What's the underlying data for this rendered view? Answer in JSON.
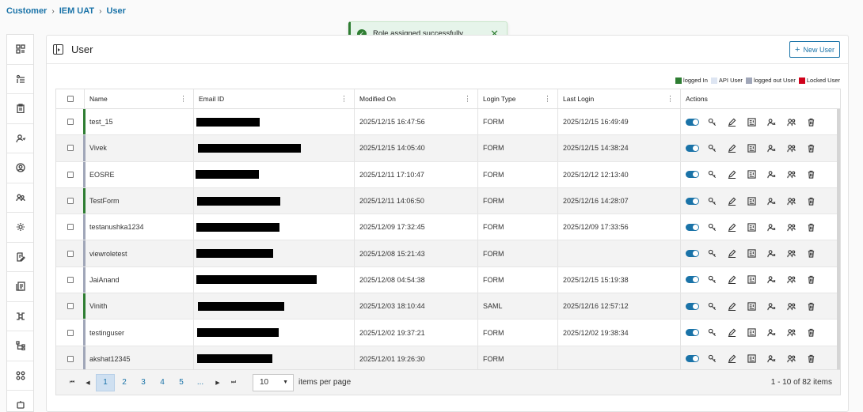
{
  "breadcrumb": [
    "Customer",
    "IEM UAT",
    "User"
  ],
  "sidebar": [
    "dashboard-icon",
    "tasks-icon",
    "clipboard-icon",
    "user-check-icon",
    "account-circle-icon",
    "group-icon",
    "settings-icon",
    "edit-doc-icon",
    "document-icon",
    "network-icon",
    "hierarchy-icon",
    "apps-icon",
    "bot-icon"
  ],
  "toast": {
    "message": "Role assigned successfully.",
    "color": "#2e7d32"
  },
  "page": {
    "title": "User",
    "new_user_label": "New User"
  },
  "legend": [
    {
      "label": "logged In",
      "color": "#2e7d32"
    },
    {
      "label": "API User",
      "color": "#dde5f2"
    },
    {
      "label": "logged out User",
      "color": "#a0a6b8"
    },
    {
      "label": "Locked User",
      "color": "#d0021b"
    }
  ],
  "columns": [
    "Name",
    "Email ID",
    "Modified On",
    "Login Type",
    "Last Login",
    "Actions"
  ],
  "rows": [
    {
      "name": "test_15",
      "modified": "2025/12/15 16:47:56",
      "login_type": "FORM",
      "last_login": "2025/12/15 16:49:49",
      "status": "logged In"
    },
    {
      "name": "Vivek",
      "modified": "2025/12/15 14:05:40",
      "login_type": "FORM",
      "last_login": "2025/12/15 14:38:24",
      "status": "logged out User"
    },
    {
      "name": "EOSRE",
      "modified": "2025/12/11 17:10:47",
      "login_type": "FORM",
      "last_login": "2025/12/12 12:13:40",
      "status": "logged out User"
    },
    {
      "name": "TestForm",
      "modified": "2025/12/11 14:06:50",
      "login_type": "FORM",
      "last_login": "2025/12/16 14:28:07",
      "status": "logged In"
    },
    {
      "name": "testanushka1234",
      "modified": "2025/12/09 17:32:45",
      "login_type": "FORM",
      "last_login": "2025/12/09 17:33:56",
      "status": "logged out User"
    },
    {
      "name": "viewroletest",
      "modified": "2025/12/08 15:21:43",
      "login_type": "FORM",
      "last_login": "",
      "status": "logged out User"
    },
    {
      "name": "JaiAnand",
      "modified": "2025/12/08 04:54:38",
      "login_type": "FORM",
      "last_login": "2025/12/15 15:19:38",
      "status": "logged out User"
    },
    {
      "name": "Vinith",
      "modified": "2025/12/03 18:10:44",
      "login_type": "SAML",
      "last_login": "2025/12/16 12:57:12",
      "status": "logged In"
    },
    {
      "name": "testinguser",
      "modified": "2025/12/02 19:37:21",
      "login_type": "FORM",
      "last_login": "2025/12/02 19:38:34",
      "status": "logged out User"
    },
    {
      "name": "akshat12345",
      "modified": "2025/12/01 19:26:30",
      "login_type": "FORM",
      "last_login": "",
      "status": "logged out User"
    }
  ],
  "row_actions": [
    "toggle-switch",
    "key-icon",
    "edit-icon",
    "assign-role-icon",
    "user-manage-icon",
    "user-group-icon",
    "delete-icon"
  ],
  "pagination": {
    "pages": [
      "1",
      "2",
      "3",
      "4",
      "5",
      "..."
    ],
    "active_page": "1",
    "page_size": "10",
    "items_per_page_label": "items per page",
    "summary": "1 - 10 of 82 items"
  }
}
